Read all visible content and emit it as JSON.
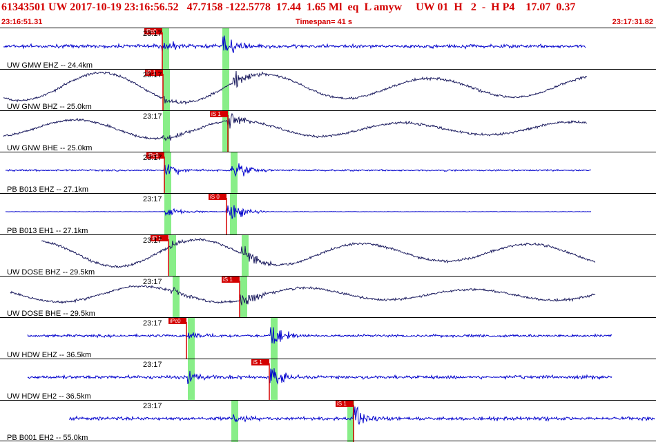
{
  "header": {
    "title": "61343501 UW 2017-10-19 23:16:56.52   47.7158 -122.5778  17.44  1.65 Ml  eq  L amyw     UW 01  H   2  -  H P4    17.07  0.37",
    "start_time": "23:16:51.31",
    "timespan": "Timespan=  41 s",
    "end_time": "23:17:31.82"
  },
  "colors": {
    "accent": "#d40000",
    "trace_blue": "#0000cc",
    "trace_navy": "#1a1a5e",
    "window_green": "#88ee88"
  },
  "traces": [
    {
      "label": "UW GMW EHZ -- 24.4km",
      "time": "23:17",
      "pick": "iPc0",
      "color": "#0000cc",
      "style": "hf",
      "amp": 4,
      "p": 235,
      "s": 323,
      "pick_at": "p",
      "lead": 5,
      "end": 848,
      "g1": 235,
      "g2": 322
    },
    {
      "label": "UW GNW BHZ -- 25.0km",
      "time": "23:17",
      "pick": "iP 1",
      "color": "#1a1a5e",
      "style": "wave",
      "amp": 22,
      "p": 236,
      "s": 338,
      "pick_at": "p",
      "lead": 5,
      "end": 850,
      "g1": 236,
      "g2": 322
    },
    {
      "label": "UW GNW BHE -- 25.0km",
      "time": "23:17",
      "pick": "iS 1",
      "color": "#1a1a5e",
      "style": "wave",
      "amp": 14,
      "p": 236,
      "s": 330,
      "pick_at": "s",
      "lead": 5,
      "end": 850,
      "g1": 236,
      "g2": 322
    },
    {
      "label": "PB B013 EHZ -- 27.1km",
      "time": "23:17",
      "pick": "iPc0",
      "color": "#0000cc",
      "style": "hf",
      "amp": 2,
      "p": 238,
      "s": 334,
      "pick_at": "p",
      "lead": 8,
      "end": 856,
      "g1": 238,
      "g2": 334
    },
    {
      "label": "PB B013 EH1 -- 27.1km",
      "time": "23:17",
      "pick": "iS 0",
      "color": "#0000cc",
      "style": "hf",
      "amp": 0.5,
      "p": 238,
      "s": 328,
      "pick_at": "s",
      "lead": 8,
      "end": 856,
      "g1": 238,
      "g2": 333
    },
    {
      "label": "UW DOSE BHZ -- 29.5km",
      "time": "23:17",
      "pick": "iP 1",
      "color": "#1a1a5e",
      "style": "wave",
      "amp": 20,
      "p": 244,
      "s": 350,
      "pick_at": "p",
      "lead": 60,
      "end": 862,
      "g1": 245,
      "g2": 350
    },
    {
      "label": "UW DOSE BHE -- 29.5km",
      "time": "23:17",
      "pick": "iS 1",
      "color": "#1a1a5e",
      "style": "wave",
      "amp": 12,
      "p": 248,
      "s": 347,
      "pick_at": "s",
      "lead": 15,
      "end": 862,
      "g1": 250,
      "g2": 348
    },
    {
      "label": "UW HDW EHZ -- 36.5km",
      "time": "23:17",
      "pick": "iPc0",
      "color": "#0000cc",
      "style": "hf",
      "amp": 3,
      "p": 270,
      "s": 392,
      "pick_at": "p",
      "lead": 40,
      "end": 886,
      "g1": 272,
      "g2": 392
    },
    {
      "label": "UW HDW EH2 -- 36.5km",
      "time": "23:17",
      "pick": "iS 1",
      "color": "#0000cc",
      "style": "hf",
      "amp": 4,
      "p": 272,
      "s": 390,
      "pick_at": "s",
      "lead": 40,
      "end": 886,
      "g1": 272,
      "g2": 392
    },
    {
      "label": "PB B001 EH2 -- 55.0km",
      "time": "23:17",
      "pick": "iS 1",
      "color": "#0000cc",
      "style": "hf",
      "amp": 4,
      "p": 335,
      "s": 512,
      "pick_at": "s",
      "lead": 100,
      "end": 948,
      "g1": 335,
      "g2": 503
    }
  ]
}
